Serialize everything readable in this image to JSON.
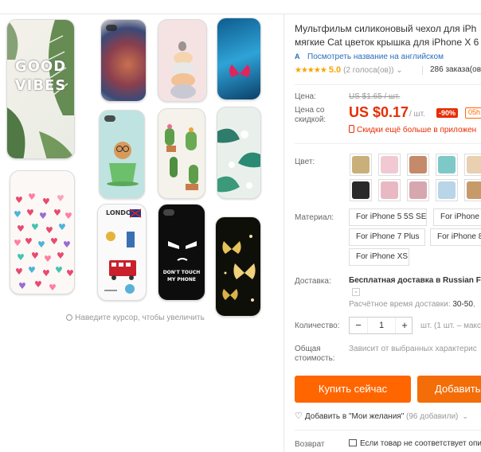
{
  "product": {
    "title_line1": "Мультфильм силиконовый чехол для iPh",
    "title_line2": "мягкие Cat цветок крышка для iPhone X 6",
    "translate_link": "Посмотреть название на английском",
    "rating_stars": "★★★★★",
    "rating_value": "5.0",
    "votes": "(2 голоса(ов))",
    "votes_chevron": "⌄",
    "orders": "286 заказа(ов"
  },
  "gallery": {
    "zoom_hint": "Наведите курсор, чтобы увеличить",
    "phone_texts": {
      "good": "GOOD",
      "vibes": "VIBES",
      "dont_touch_1": "DON'T TOUCH",
      "dont_touch_2": "MY PHONE",
      "london": "LONDON"
    }
  },
  "price": {
    "label_price": "Цена:",
    "old_price": "US $1.65 / шт.",
    "label_discount": "Цена со скидкой:",
    "new_price": "US $0.17",
    "per_unit": "/ шт.",
    "discount_badge": "-90%",
    "timer": "05h",
    "app_promo": "Скидки ещё больше в приложен"
  },
  "options": {
    "color_label": "Цвет:",
    "swatch_colors": [
      "#c9b07a",
      "#f1c9d3",
      "#c48a6a",
      "#7ec9c8",
      "#e8d0b0",
      "#2a2a2a",
      "#e9b9c3",
      "#d7a7b0",
      "#b9d5e8",
      "#c79a6a"
    ],
    "material_label": "Материал:",
    "materials": [
      "For iPhone 5 5S SE",
      "For iPhone",
      "For iPhone 7 Plus",
      "For iPhone 8",
      "For iPhone XS"
    ]
  },
  "shipping": {
    "label": "Доставка:",
    "method": "Бесплатная доставка в Russian Fe",
    "chevron": "⌄",
    "time_label": "Расчётное время доставки:",
    "time_value": "30-50",
    "time_suffix": ","
  },
  "quantity": {
    "label": "Количество:",
    "minus": "−",
    "value": "1",
    "plus": "+",
    "note": "шт. (1 шт. – макс"
  },
  "total": {
    "label": "Общая стоимость:",
    "note": "Зависит от выбранных характерис"
  },
  "actions": {
    "buy_now": "Купить сейчас",
    "add_to_cart": "Добавить",
    "wishlist": "Добавить в \"Мои желания\"",
    "wishlist_count": "(96 добавили)",
    "wishlist_chevron": "⌄"
  },
  "returns": {
    "label": "Возврат",
    "text": "Если товар не соответствует опи"
  },
  "colors": {
    "accent_orange": "#ff6600",
    "price_red": "#e62e04",
    "star_gold": "#f7a400",
    "link_blue": "#2a6ebb"
  }
}
